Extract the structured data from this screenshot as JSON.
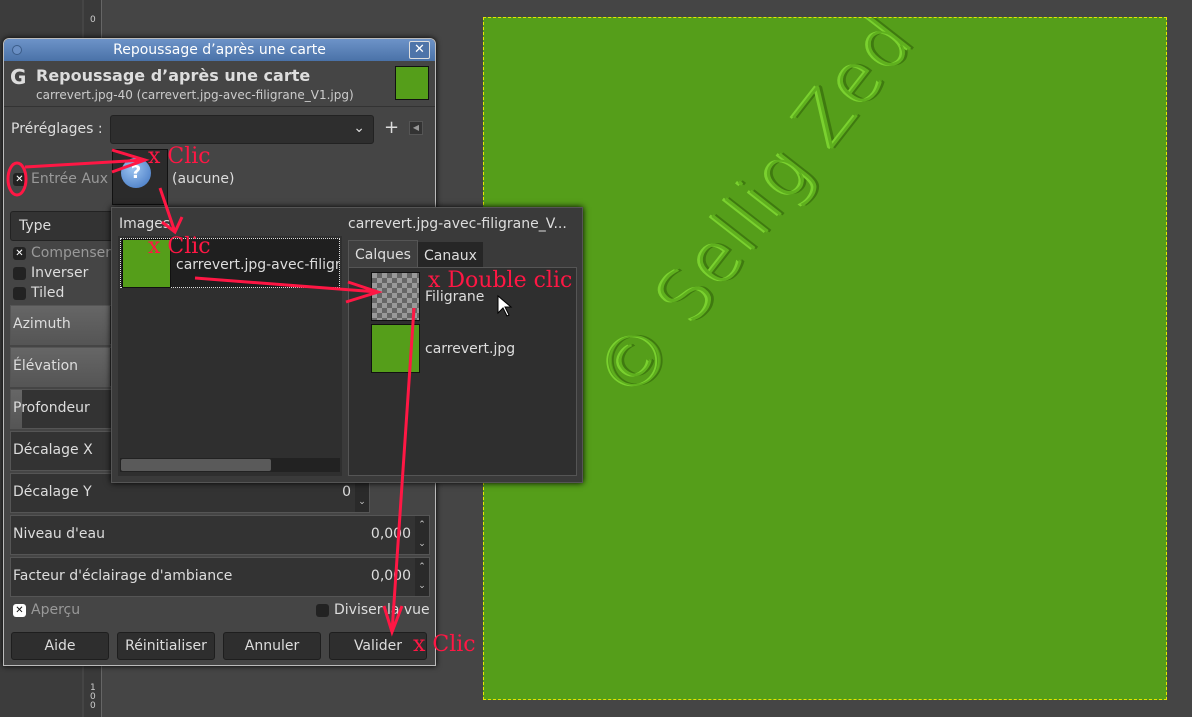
{
  "ruler": {
    "ticks": [
      "0",
      "100"
    ]
  },
  "canvas": {
    "color": "#559e1a",
    "watermark": "© Sellig Zed"
  },
  "dialog": {
    "window_title": "Repoussage d’après une carte",
    "close_icon": "close-icon",
    "header_title": "Repoussage d’après une carte",
    "header_subtitle": "carrevert.jpg-40 (carrevert.jpg-avec-filigrane_V1.jpg)",
    "presets_label": "Préréglages :",
    "presets_value": "",
    "add_preset": "+",
    "aux_label": "Entrée Aux",
    "aux_checked": true,
    "aux_value": "(aucune)",
    "type_label": "Type",
    "checkboxes": [
      {
        "label": "Compenser",
        "checked": true
      },
      {
        "label": "Inverser",
        "checked": false
      },
      {
        "label": "Tiled",
        "checked": false
      }
    ],
    "sliders": [
      {
        "label": "Azimuth"
      },
      {
        "label": "Élévation"
      },
      {
        "label": "Profondeur"
      },
      {
        "label": "Décalage X"
      },
      {
        "label": "Décalage Y",
        "value": "0"
      },
      {
        "label": "Niveau d'eau",
        "value": "0,000"
      },
      {
        "label": "Facteur d'éclairage d'ambiance",
        "value": "0,000"
      }
    ],
    "preview_label": "Aperçu",
    "preview_checked": true,
    "split_label": "Diviser la vue",
    "split_checked": false,
    "buttons": {
      "help": "Aide",
      "reset": "Réinitialiser",
      "cancel": "Annuler",
      "ok": "Valider"
    }
  },
  "popup": {
    "images_label": "Images",
    "image_item": "carrevert.jpg-avec-filigr",
    "image_title": "carrevert.jpg-avec-filigrane_V...",
    "tabs": [
      "Calques",
      "Canaux"
    ],
    "layers": [
      "Filigrane",
      "carrevert.jpg"
    ]
  },
  "annotations": {
    "color": "#ff1744",
    "a1": "x Clic",
    "a2": "x Clic",
    "a3": "x Double clic",
    "a4": "x Clic"
  }
}
